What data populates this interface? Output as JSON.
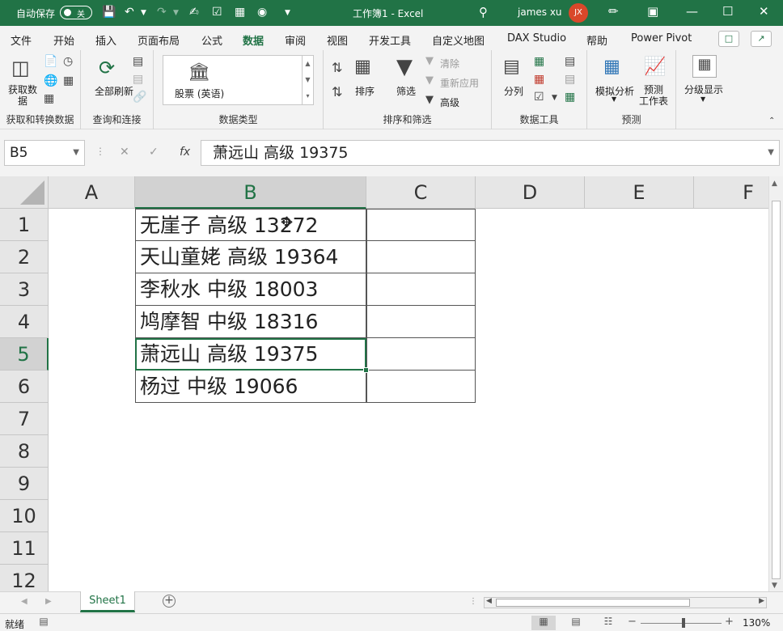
{
  "titlebar": {
    "autosave_label": "自动保存",
    "autosave_state": "关",
    "doc_title": "工作簿1  -  Excel",
    "user_name": "james xu",
    "user_initials": "JX"
  },
  "menu": {
    "tabs": [
      "文件",
      "开始",
      "插入",
      "页面布局",
      "公式",
      "数据",
      "审阅",
      "视图",
      "开发工具",
      "自定义地图",
      "DAX Studio",
      "帮助",
      "Power Pivot"
    ],
    "active_tab": "数据"
  },
  "ribbon": {
    "get_data": "获取数\n据",
    "group_get_transform": "获取和转换数据",
    "refresh_all": "全部刷新",
    "group_queries": "查询和连接",
    "stock": "股票 (英语)",
    "group_datatypes": "数据类型",
    "sort": "排序",
    "filter": "筛选",
    "clear": "清除",
    "reapply": "重新应用",
    "advanced": "高级",
    "group_sort_filter": "排序和筛选",
    "text_to_columns": "分列",
    "group_data_tools": "数据工具",
    "what_if": "模拟分析",
    "forecast_sheet": "预测\n工作表",
    "group_forecast": "预测",
    "outline": "分级显示"
  },
  "formula_bar": {
    "name_box": "B5",
    "content": "萧远山 高级 19375"
  },
  "sheet": {
    "columns": [
      "A",
      "B",
      "C",
      "D",
      "E",
      "F"
    ],
    "rows": [
      "1",
      "2",
      "3",
      "4",
      "5",
      "6",
      "7",
      "8",
      "9",
      "10",
      "11",
      "12"
    ],
    "selected_column": "B",
    "selected_row": "5",
    "b_values": [
      "无崖子 高级 13272",
      "天山童姥 高级 19364",
      "李秋水 中级 18003",
      "鸠摩智 中级 18316",
      "萧远山 高级 19375",
      "杨过 中级 19066"
    ]
  },
  "sheet_tabs": {
    "active": "Sheet1"
  },
  "status": {
    "ready": "就绪",
    "zoom": "130%"
  }
}
